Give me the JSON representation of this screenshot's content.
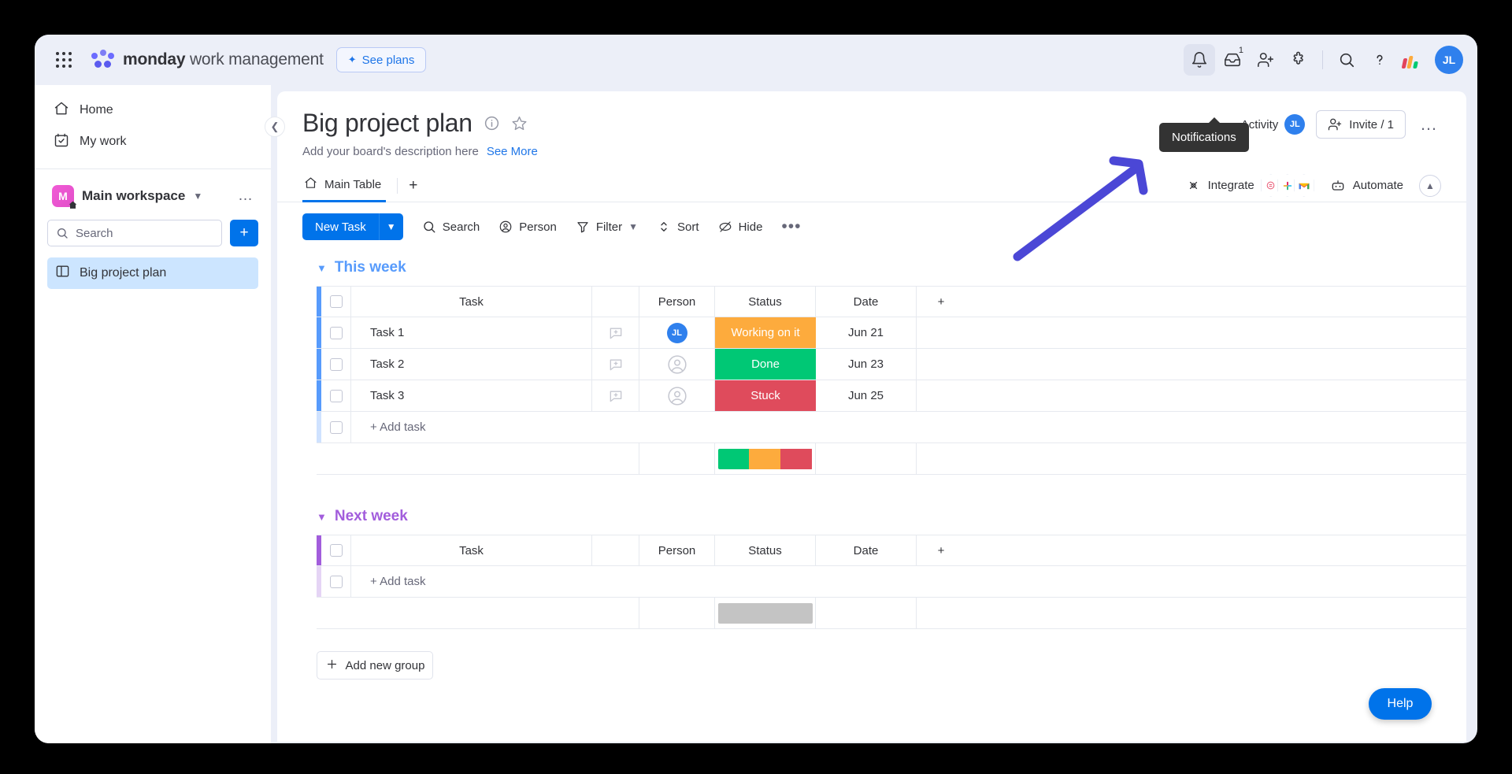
{
  "topbar": {
    "apps_icon": "apps-grid-icon",
    "brand_bold": "monday",
    "brand_light": " work management",
    "see_plans": "See plans",
    "icons": [
      {
        "name": "notifications-bell-icon",
        "label": "Notifications"
      },
      {
        "name": "inbox-icon",
        "label": "Inbox",
        "badge": "1"
      },
      {
        "name": "invite-member-icon",
        "label": "Invite members"
      },
      {
        "name": "apps-marketplace-icon",
        "label": "Apps"
      },
      {
        "name": "search-icon",
        "label": "Search"
      },
      {
        "name": "help-question-icon",
        "label": "Help"
      }
    ],
    "avatar_initials": "JL"
  },
  "sidebar": {
    "items": [
      {
        "label": "Home",
        "icon": "home-icon"
      },
      {
        "label": "My work",
        "icon": "my-work-calendar-icon"
      }
    ],
    "workspace": {
      "initial": "M",
      "name": "Main workspace",
      "search_placeholder": "Search",
      "add_label": "+"
    },
    "boards": [
      {
        "label": "Big project plan",
        "selected": true
      }
    ]
  },
  "board": {
    "title": "Big project plan",
    "description": "Add your board's description here",
    "see_more": "See More",
    "activity_label": "Activity",
    "activity_avatar": "JL",
    "invite_label": "Invite / 1",
    "tabs": [
      {
        "label": "Main Table",
        "icon": "home-icon",
        "selected": true
      }
    ],
    "tab_add": "+",
    "integrate_label": "Integrate",
    "automate_label": "Automate",
    "integration_icons": [
      "dropbox-hex-icon",
      "slack-hex-icon",
      "gmail-hex-icon"
    ]
  },
  "toolbar": {
    "new_task": "New Task",
    "items": [
      {
        "label": "Search",
        "icon": "search-icon"
      },
      {
        "label": "Person",
        "icon": "person-icon"
      },
      {
        "label": "Filter",
        "icon": "filter-funnel-icon",
        "caret": true
      },
      {
        "label": "Sort",
        "icon": "sort-icon"
      },
      {
        "label": "Hide",
        "icon": "hide-eye-icon"
      }
    ],
    "more": "•••"
  },
  "columns": [
    "Task",
    "Person",
    "Status",
    "Date"
  ],
  "groups": [
    {
      "name": "This week",
      "color": "#579bfc",
      "rows": [
        {
          "task": "Task 1",
          "person": "JL",
          "status": "Working on it",
          "status_color": "#fdab3d",
          "date": "Jun 21"
        },
        {
          "task": "Task 2",
          "person": "",
          "status": "Done",
          "status_color": "#00c875",
          "date": "Jun 23"
        },
        {
          "task": "Task 3",
          "person": "",
          "status": "Stuck",
          "status_color": "#df4b5c",
          "date": "Jun 25"
        }
      ],
      "add_task": "+ Add task",
      "summary_segments": [
        {
          "color": "#00c875",
          "pct": 33.3
        },
        {
          "color": "#fdab3d",
          "pct": 33.3
        },
        {
          "color": "#df4b5c",
          "pct": 33.4
        }
      ]
    },
    {
      "name": "Next week",
      "color": "#a25ddc",
      "rows": [],
      "add_task": "+ Add task",
      "summary_segments": [
        {
          "color": "#c4c4c4",
          "pct": 100
        }
      ]
    }
  ],
  "add_new_group": "Add new group",
  "help_button": "Help",
  "tooltip": "Notifications"
}
